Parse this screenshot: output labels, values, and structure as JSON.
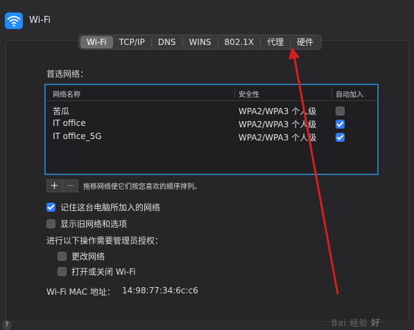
{
  "window": {
    "title": "Wi-Fi"
  },
  "tabs": [
    {
      "label": "Wi-Fi",
      "active": true
    },
    {
      "label": "TCP/IP"
    },
    {
      "label": "DNS"
    },
    {
      "label": "WINS"
    },
    {
      "label": "802.1X"
    },
    {
      "label": "代理"
    },
    {
      "label": "硬件"
    }
  ],
  "preferred": {
    "section_label": "首选网络：",
    "columns": [
      "网络名称",
      "安全性",
      "自动加入"
    ],
    "rows": [
      {
        "name": "苦瓜",
        "security": "WPA2/WPA3 个人级",
        "auto_join": false
      },
      {
        "name": "IT office",
        "security": "WPA2/WPA3 个人级",
        "auto_join": true
      },
      {
        "name": "IT office_5G",
        "security": "WPA2/WPA3 个人级",
        "auto_join": true
      }
    ],
    "add_label": "+",
    "remove_label": "−",
    "drag_hint": "拖移网络使它们按您喜欢的顺序排列。"
  },
  "options": {
    "remember_networks": {
      "label": "记住这台电脑所加入的网络",
      "checked": true
    },
    "show_legacy": {
      "label": "显示旧网络和选项",
      "checked": false
    }
  },
  "admin": {
    "label": "进行以下操作需要管理员授权：",
    "change_networks": {
      "label": "更改网络",
      "checked": false
    },
    "toggle_wifi": {
      "label": "打开或关闭 Wi-Fi",
      "checked": false
    }
  },
  "mac": {
    "label": "Wi-Fi MAC 地址：",
    "value": "14:98:77:34:6c:c6"
  },
  "help": {
    "label": "?"
  },
  "watermark": {
    "text": "Bai 经验",
    "tail": "好"
  },
  "colors": {
    "accent": "#2f7cf6",
    "table_border": "#2f79b5",
    "arrow": "#d61f1f"
  }
}
